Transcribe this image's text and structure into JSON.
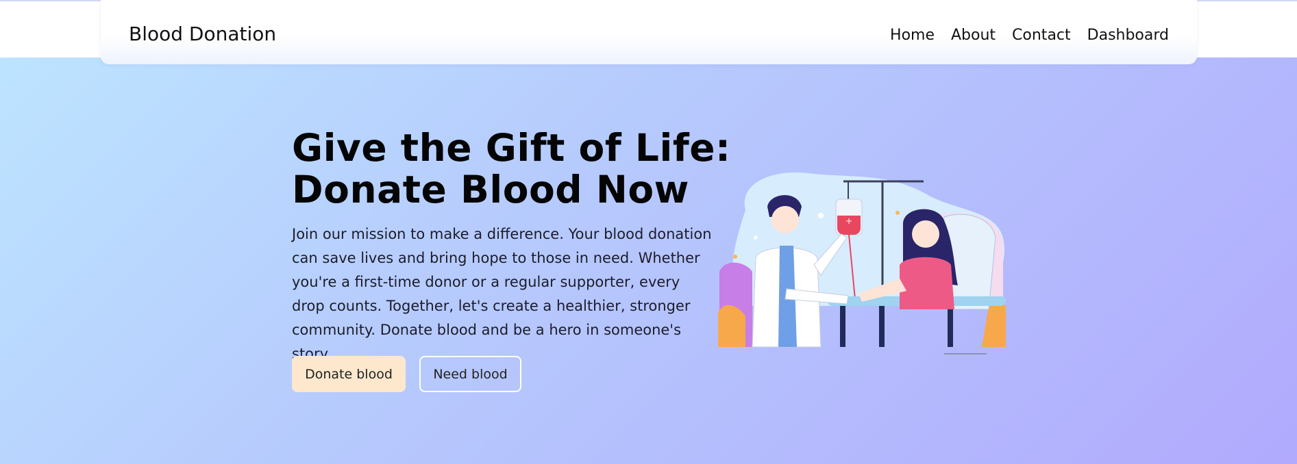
{
  "nav": {
    "brand": "Blood Donation",
    "links": [
      "Home",
      "About",
      "Contact",
      "Dashboard"
    ]
  },
  "hero": {
    "title_line1": "Give the Gift of Life:",
    "title_line2": "Donate Blood Now",
    "description": "Join our mission to make a difference. Your blood donation can save lives and bring hope to those in need. Whether you're a first-time donor or a regular supporter, every drop counts. Together, let's create a healthier, stronger community. Donate blood and be a hero in someone's story",
    "primary_button": "Donate blood",
    "secondary_button": "Need blood"
  },
  "colors": {
    "background_start": "#bde6ff",
    "background_end": "#b1aafd",
    "primary_button_bg": "#fde7cd",
    "blood_red": "#e8475f"
  },
  "illustration": {
    "icon": "blood-donation-illustration"
  }
}
